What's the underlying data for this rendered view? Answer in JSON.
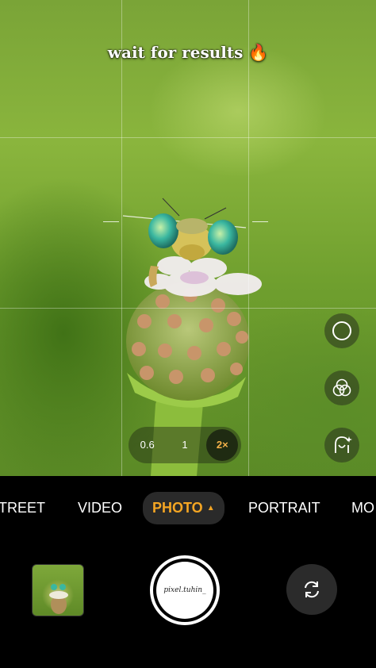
{
  "overlay": {
    "caption": "wait for results 🔥"
  },
  "viewfinder": {
    "subject": "damselfly on flower bud"
  },
  "side_controls": {
    "icons": [
      "circle-icon",
      "filters-icon",
      "portrait-retouch-icon"
    ]
  },
  "zoom": {
    "options": [
      "0.6",
      "1",
      "2×"
    ],
    "selected": "2×"
  },
  "modes": {
    "items": [
      "TREET",
      "VIDEO",
      "PHOTO",
      "PORTRAIT",
      "MO"
    ],
    "active": "PHOTO"
  },
  "bottom": {
    "watermark": "pixel.tuhin_"
  },
  "colors": {
    "accent": "#f5a623",
    "background": "#000000"
  }
}
